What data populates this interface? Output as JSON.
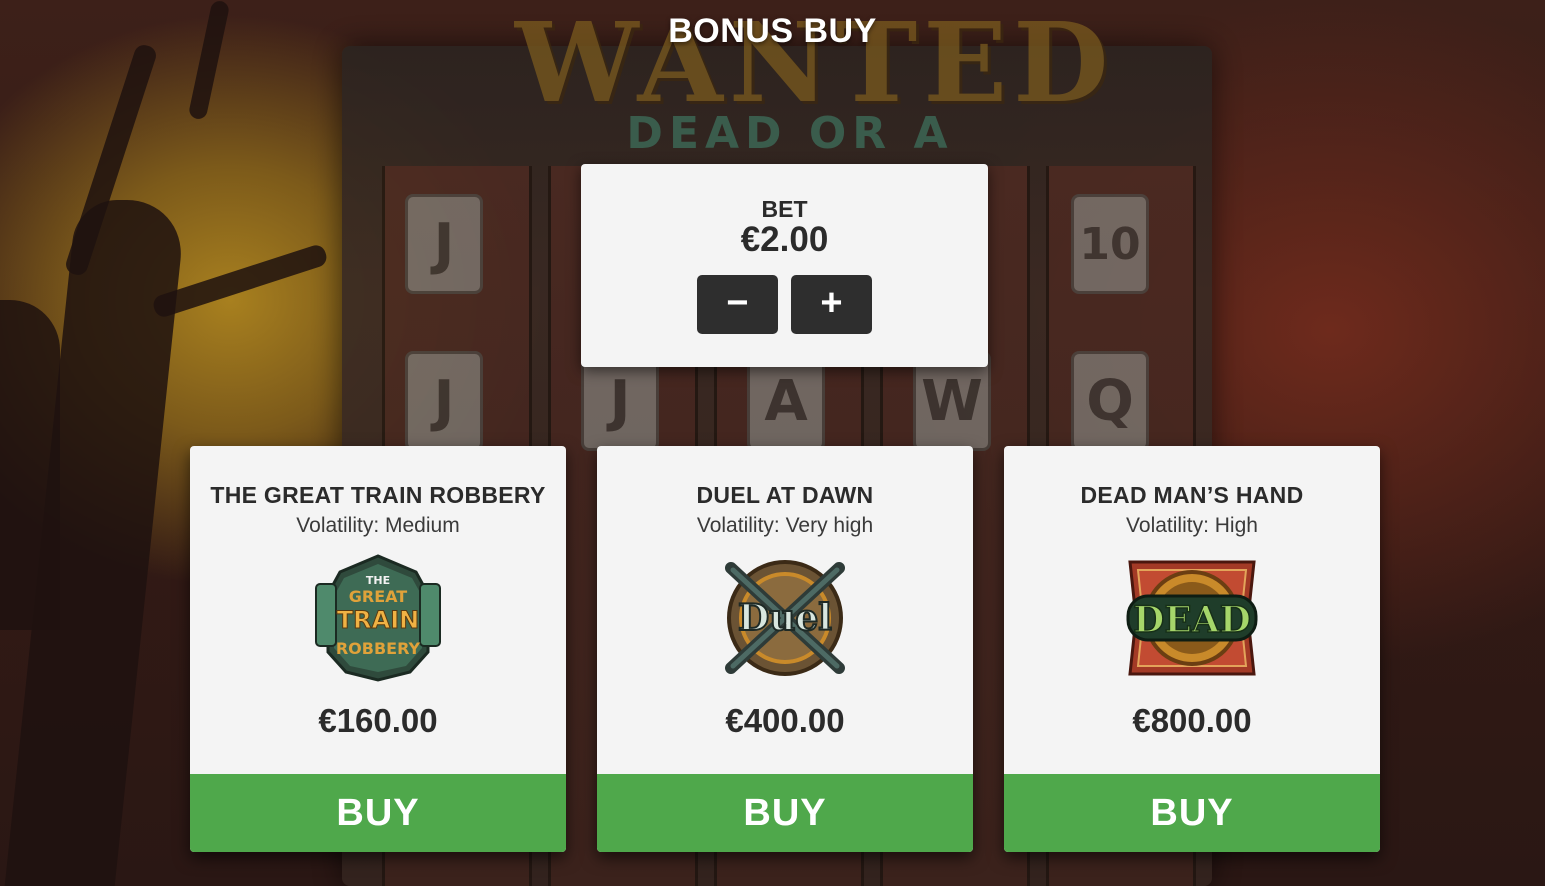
{
  "background": {
    "logo_main": "WANTED",
    "logo_sub": "DEAD OR A WILD",
    "reel_symbols": [
      "J",
      "10",
      "J",
      "J",
      "A",
      "W",
      "Q"
    ]
  },
  "overlay": {
    "title": "BONUS BUY"
  },
  "bet": {
    "label": "BET",
    "value": "€2.00",
    "decrease_icon": "minus-icon",
    "decrease_label": "−",
    "increase_icon": "plus-icon",
    "increase_label": "+"
  },
  "offers": [
    {
      "title": "THE GREAT TRAIN ROBBERY",
      "volatility": "Volatility: Medium",
      "badge_text": [
        "THE",
        "GREAT",
        "TRAIN",
        "ROBBERY"
      ],
      "price": "€160.00",
      "buy_label": "BUY"
    },
    {
      "title": "DUEL AT DAWN",
      "volatility": "Volatility: Very high",
      "badge_text": [
        "Duel"
      ],
      "price": "€400.00",
      "buy_label": "BUY"
    },
    {
      "title": "DEAD MAN’S HAND",
      "volatility": "Volatility: High",
      "badge_text": [
        "DEAD"
      ],
      "price": "€800.00",
      "buy_label": "BUY"
    }
  ],
  "colors": {
    "buy_green": "#4fa84b",
    "panel_bg": "#f4f4f4",
    "stepper_bg": "#2e2e2e",
    "text_dark": "#2b2b2b"
  }
}
